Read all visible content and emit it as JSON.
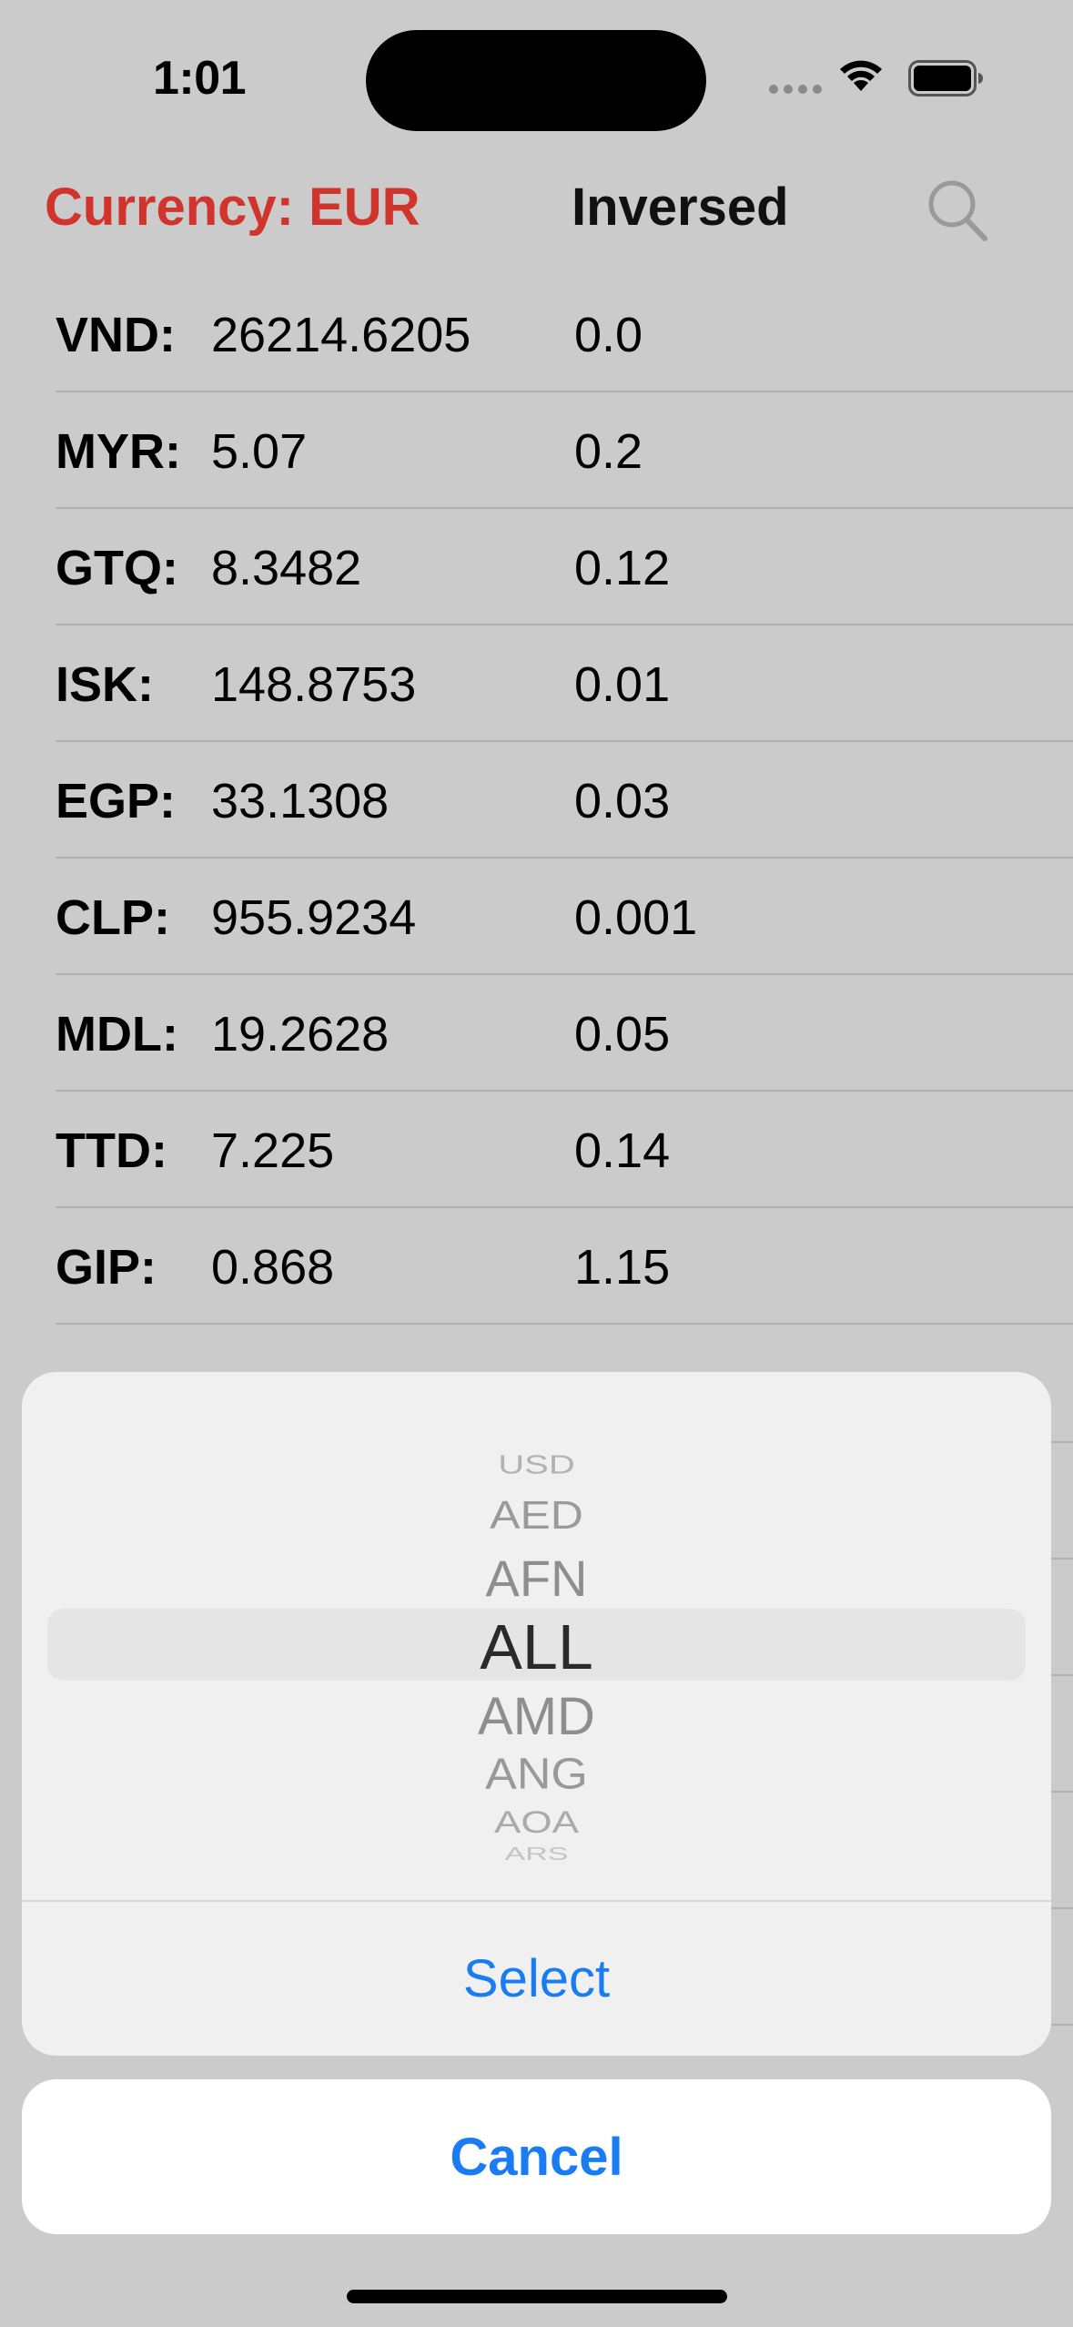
{
  "status_bar": {
    "time": "1:01"
  },
  "header": {
    "currency_label": "Currency: EUR",
    "inversed_label": "Inversed",
    "search_icon": "magnifying-glass-icon"
  },
  "rates": [
    {
      "code": "VND:",
      "rate": "26214.6205",
      "inverse": "0.0"
    },
    {
      "code": "MYR:",
      "rate": "5.07",
      "inverse": "0.2"
    },
    {
      "code": "GTQ:",
      "rate": "8.3482",
      "inverse": "0.12"
    },
    {
      "code": "ISK:",
      "rate": "148.8753",
      "inverse": "0.01"
    },
    {
      "code": "EGP:",
      "rate": "33.1308",
      "inverse": "0.03"
    },
    {
      "code": "CLP:",
      "rate": "955.9234",
      "inverse": "0.001"
    },
    {
      "code": "MDL:",
      "rate": "19.2628",
      "inverse": "0.05"
    },
    {
      "code": "TTD:",
      "rate": "7.225",
      "inverse": "0.14"
    },
    {
      "code": "GIP:",
      "rate": "0.868",
      "inverse": "1.15"
    }
  ],
  "picker": {
    "options": [
      "USD",
      "AED",
      "AFN",
      "ALL",
      "AMD",
      "ANG",
      "AOA",
      "ARS"
    ],
    "selected": "ALL"
  },
  "actions": {
    "select_label": "Select",
    "cancel_label": "Cancel"
  },
  "colors": {
    "accent": "#1a7cf2",
    "currency_red": "#d0342c",
    "background": "#cbcbcb"
  }
}
